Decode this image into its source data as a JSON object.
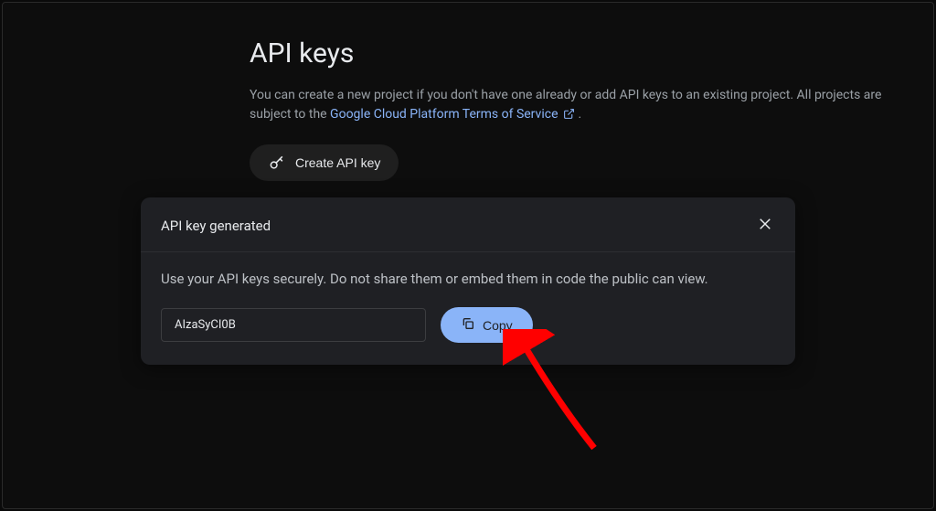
{
  "page": {
    "title": "API keys",
    "description_prefix": "You can create a new project if you don't have one already or add API keys to an existing project. All projects are subject to the ",
    "link_text": "Google Cloud Platform Terms of Service",
    "description_suffix": ".",
    "create_button": "Create API key"
  },
  "modal": {
    "title": "API key generated",
    "instruction": "Use your API keys securely. Do not share them or embed them in code the public can view.",
    "api_key_visible": "AIzaSyCI0B",
    "copy_button": "Copy"
  }
}
